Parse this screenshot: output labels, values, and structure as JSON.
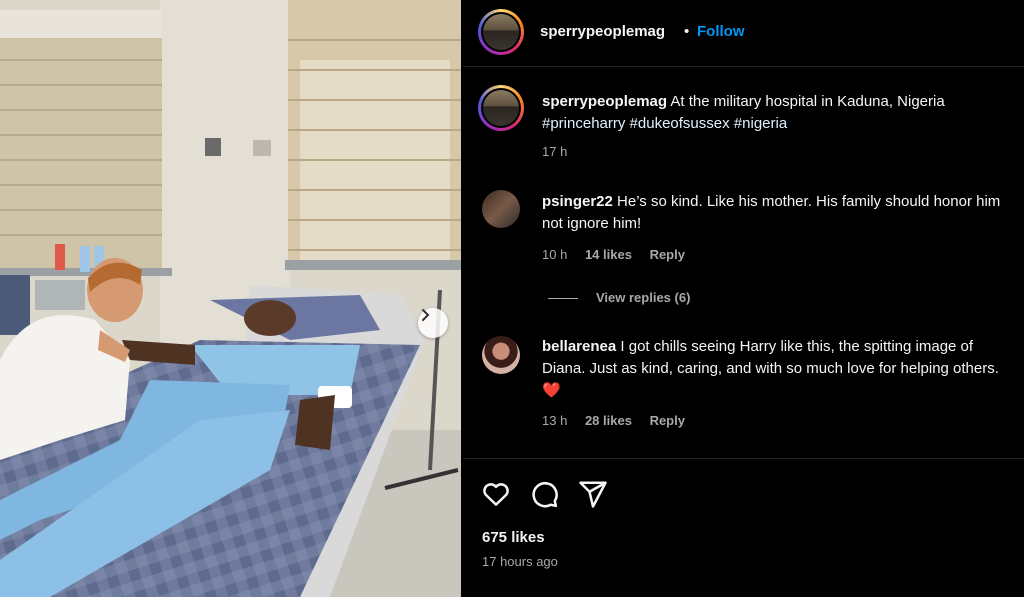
{
  "post": {
    "username": "sperrypeoplemag",
    "follow_label": "Follow",
    "separator": "•",
    "caption": {
      "username": "sperrypeoplemag",
      "text": "At the military hospital in Kaduna, Nigeria",
      "hashtags": [
        "#princeharry",
        "#dukeofsussex",
        "#nigeria"
      ],
      "time": "17 h"
    },
    "likes": "675 likes",
    "posted": "17 hours ago"
  },
  "comments": [
    {
      "username": "psinger22",
      "text": "He’s so kind. Like his mother. His family should honor him not ignore him!",
      "time": "10 h",
      "likes": "14 likes",
      "reply": "Reply",
      "view_replies": "View replies (6)"
    },
    {
      "username": "bellarenea",
      "text": "I got chills seeing Harry like this, the spitting image of Diana. Just as kind, caring, and with so much love for helping others.",
      "emoji": "❤️",
      "time": "13 h",
      "likes": "28 likes",
      "reply": "Reply"
    }
  ],
  "icons": {
    "like": "heart-icon",
    "comment": "comment-icon",
    "share": "share-icon",
    "next": "chevron-right-icon"
  },
  "colors": {
    "link": "#0095f6",
    "muted": "#a8a8a8",
    "background": "#000000",
    "divider": "#262626"
  }
}
